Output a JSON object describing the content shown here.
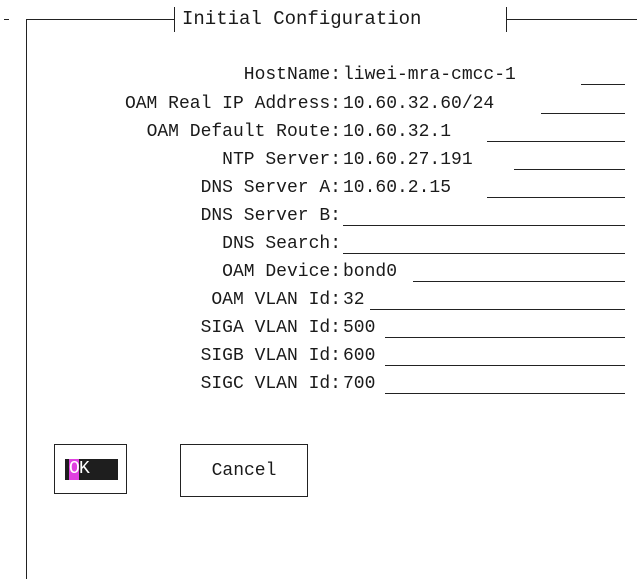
{
  "dialog": {
    "title": "Initial Configuration"
  },
  "fields": [
    {
      "label": "HostName:",
      "value": "liwei-mra-cmcc-1"
    },
    {
      "label": "OAM Real IP Address:",
      "value": "10.60.32.60/24"
    },
    {
      "label": "OAM Default Route:",
      "value": "10.60.32.1"
    },
    {
      "label": "NTP Server:",
      "value": "10.60.27.191"
    },
    {
      "label": "DNS Server A:",
      "value": "10.60.2.15"
    },
    {
      "label": "DNS Server B:",
      "value": ""
    },
    {
      "label": "DNS Search:",
      "value": ""
    },
    {
      "label": "OAM Device:",
      "value": "bond0"
    },
    {
      "label": "OAM VLAN Id:",
      "value": "32"
    },
    {
      "label": "SIGA VLAN Id:",
      "value": "500"
    },
    {
      "label": "SIGB VLAN Id:",
      "value": "600"
    },
    {
      "label": "SIGC VLAN Id:",
      "value": "700"
    }
  ],
  "buttons": {
    "ok_hotkey": "O",
    "ok_rest": "K",
    "cancel_label": "Cancel"
  },
  "colors": {
    "cursor_highlight": "#e040e0",
    "selected_button_bg": "#1e1e1e"
  }
}
